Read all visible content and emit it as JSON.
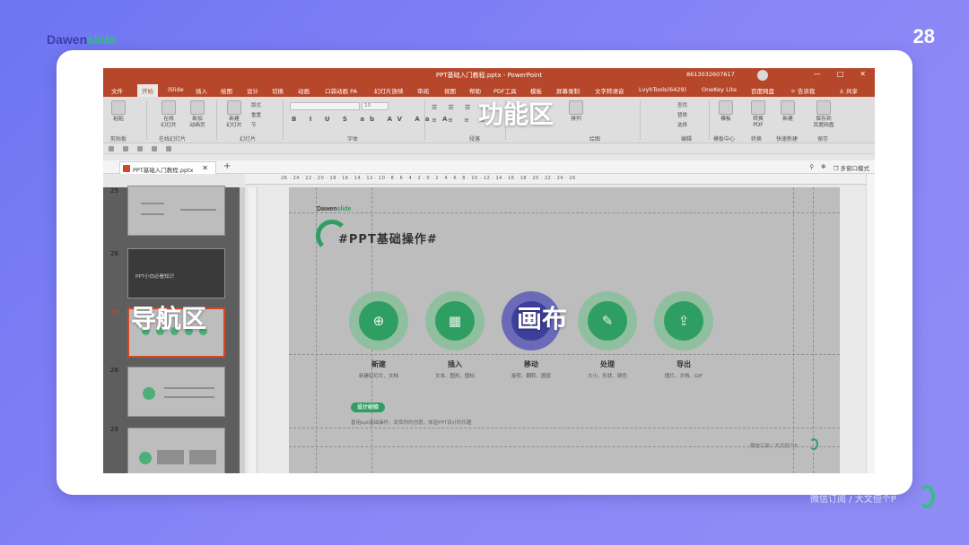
{
  "brand": {
    "name_prefix": "Dawen",
    "name_accent": "slide"
  },
  "page_number": "28",
  "footer": {
    "text": "微信订阅 / 大文但个P"
  },
  "colors": {
    "background": "#7b7ff5",
    "ppt_red": "#b7472a",
    "accent_green": "#2ec27e",
    "purple": "#3e3e9c"
  },
  "app": {
    "title": "PPT基础入门教程.pptx - PowerPoint",
    "account": "8613032607617",
    "window_buttons": [
      "—",
      "□",
      "✕"
    ],
    "tabs": [
      "文件",
      "开始",
      "iSlide",
      "插入",
      "绘图",
      "设计",
      "切换",
      "动画",
      "口袋动画 PA",
      "幻灯片放映",
      "审阅",
      "视图",
      "帮助",
      "PDF工具",
      "模板",
      "屏幕录制",
      "文字转语音",
      "LvyhTools(6429)",
      "OneKey Lite",
      "百度网盘",
      "告诉我",
      "共享"
    ],
    "ribbon": {
      "buttons": [
        "粘贴",
        "在线\n幻灯片",
        "新加\n动画页",
        "新建\n幻灯片",
        "排列",
        "模板",
        "转换\nPDF",
        "新建",
        "保存到\n百度网盘"
      ],
      "mini": [
        "版式",
        "重置",
        "节",
        "查找",
        "替换",
        "选择"
      ],
      "font_name": "",
      "font_size": "10",
      "groups": [
        "剪贴板",
        "在线幻灯片",
        "幻灯片",
        "字体",
        "段落",
        "绘图",
        "编辑",
        "模板中心",
        "转换",
        "快速新建",
        "保存"
      ]
    },
    "doc_tab": "PPT基础入门教程.pptx",
    "doc_tab_close": "✕",
    "new_tab": "+",
    "view_mode": "多窗口模式",
    "ruler_text": "26 · 24 · 22 · 20 · 18 · 16 · 14 · 12 · 10 · 8 · 6 · 4 · 2 · 0 · 2 · 4 · 6 · 8 · 10 · 12 · 14 · 16 · 18 · 20 · 22 · 24 · 26"
  },
  "nav": {
    "slides": [
      {
        "num": "25"
      },
      {
        "num": "26"
      },
      {
        "num": "27"
      },
      {
        "num": "28"
      },
      {
        "num": "29"
      }
    ],
    "thumb26_title": "PPT小白必看知识"
  },
  "slide": {
    "logo_prefix": "Dawen",
    "logo_accent": "slide",
    "title": "#PPT基础操作#",
    "circles": [
      {
        "icon": "⊕",
        "name": "新建",
        "desc": "新建幻灯片、文档"
      },
      {
        "icon": "▦",
        "name": "插入",
        "desc": "文本、图形、图标"
      },
      {
        "icon": "✥",
        "name": "移动",
        "desc": "旋转、翻转、图层"
      },
      {
        "icon": "✎",
        "name": "处理",
        "desc": "大小、形状、颜色"
      },
      {
        "icon": "⇪",
        "name": "导出",
        "desc": "图片、文档、GIF"
      }
    ],
    "badge": "设计经验",
    "desc": "善用ppt基础操作，发挥你的创意，体验PPT设计的乐趣",
    "footer": "微信订阅 / 大文但个P"
  },
  "callouts": {
    "ribbon": "功能区",
    "nav": "导航区",
    "canvas": "画布"
  }
}
